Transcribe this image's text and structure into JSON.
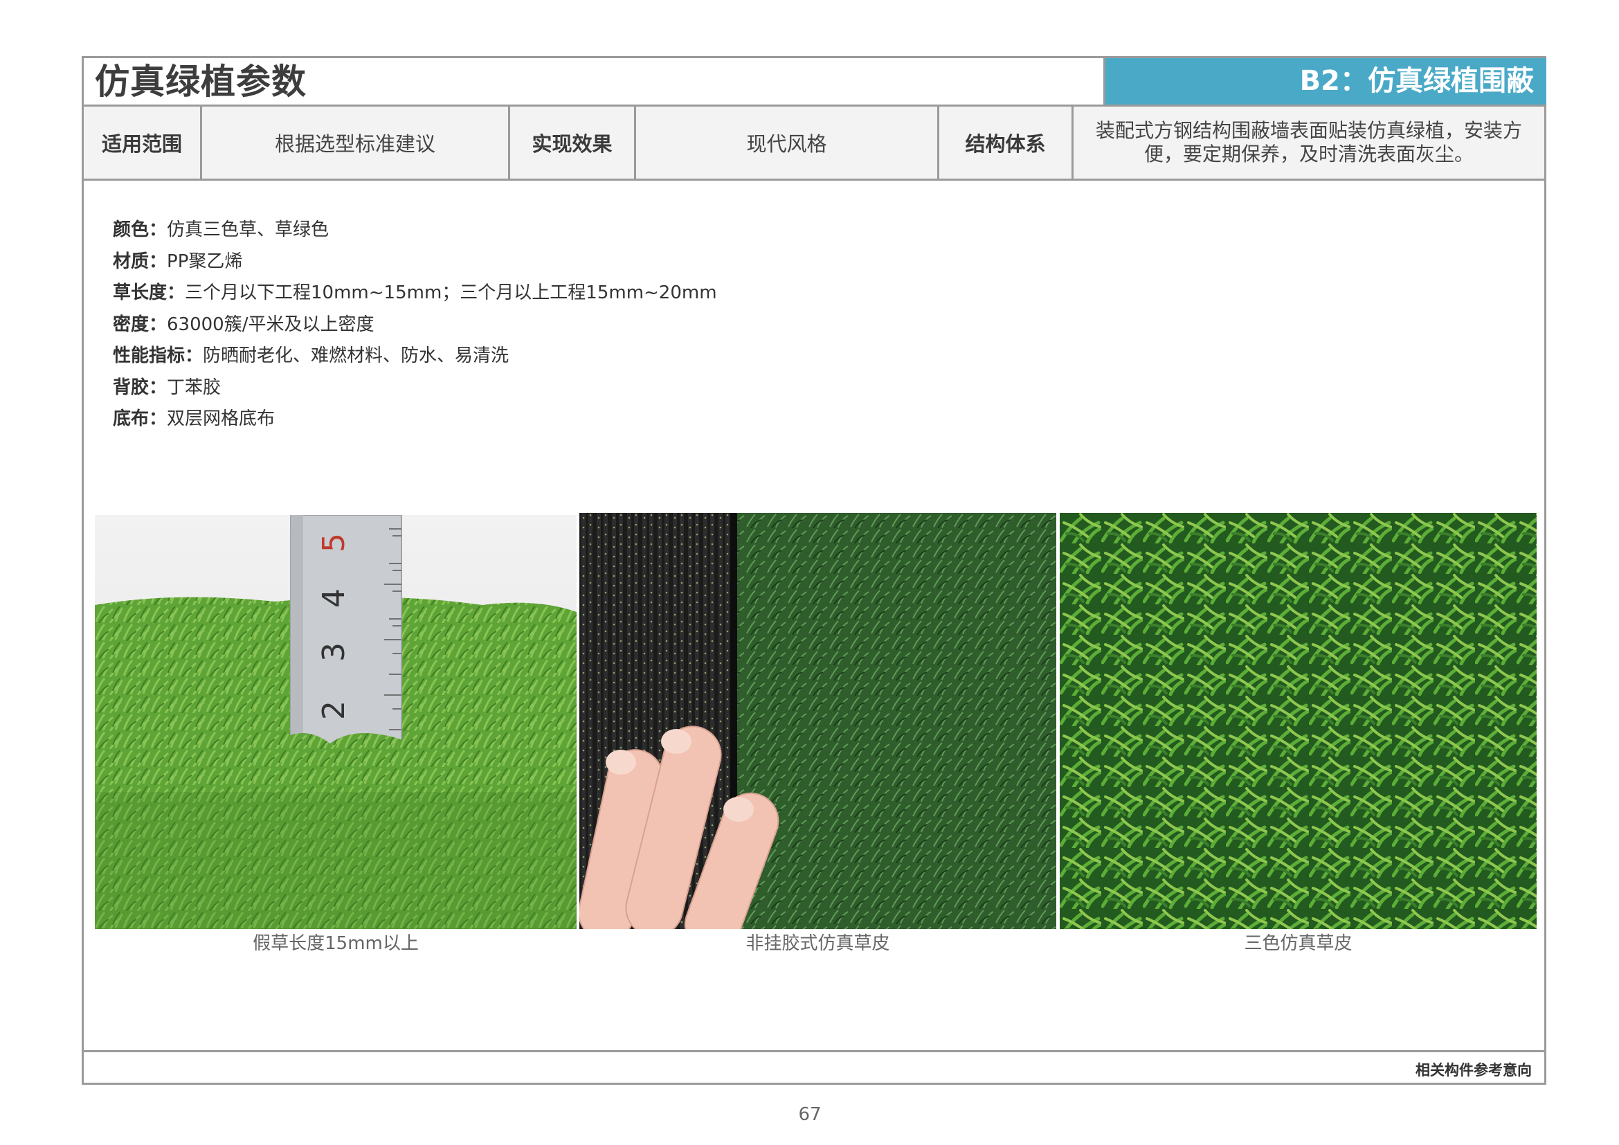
{
  "header": {
    "title": "仿真绿植参数",
    "section": "B2：仿真绿植围蔽"
  },
  "info_row": {
    "scope_label": "适用范围",
    "scope_value": "根据选型标准建议",
    "effect_label": "实现效果",
    "effect_value": "现代风格",
    "structure_label": "结构体系",
    "structure_value": "装配式方钢结构围蔽墙表面贴装仿真绿植，安装方便，要定期保养，及时清洗表面灰尘。"
  },
  "specs": [
    {
      "label": "颜色：",
      "value": "仿真三色草、草绿色"
    },
    {
      "label": "材质：",
      "value": "PP聚乙烯"
    },
    {
      "label": "草长度：",
      "value": "三个月以下工程10mm~15mm；三个月以上工程15mm~20mm"
    },
    {
      "label": "密度：",
      "value": "63000簇/平米及以上密度"
    },
    {
      "label": "性能指标：",
      "value": "防晒耐老化、难燃材料、防水、易清洗"
    },
    {
      "label": "背胶：",
      "value": "丁苯胶"
    },
    {
      "label": "底布：",
      "value": "双层网格底布"
    }
  ],
  "photos": [
    {
      "caption": "假草长度15mm以上",
      "icon": "grass-with-ruler-photo",
      "ruler_marks": [
        "5",
        "4",
        "3",
        "2"
      ]
    },
    {
      "caption": "非挂胶式仿真草皮",
      "icon": "grass-backing-hand-photo"
    },
    {
      "caption": "三色仿真草皮",
      "icon": "tricolor-grass-photo"
    }
  ],
  "footer": {
    "label": "相关构件参考意向",
    "page_number": "67"
  },
  "colors": {
    "accent": "#4aa9c6",
    "border": "#9a9a9a",
    "header_bg": "#f3f3f3",
    "grass_light": "#6fb13e",
    "grass_dark": "#2c6a1f"
  }
}
